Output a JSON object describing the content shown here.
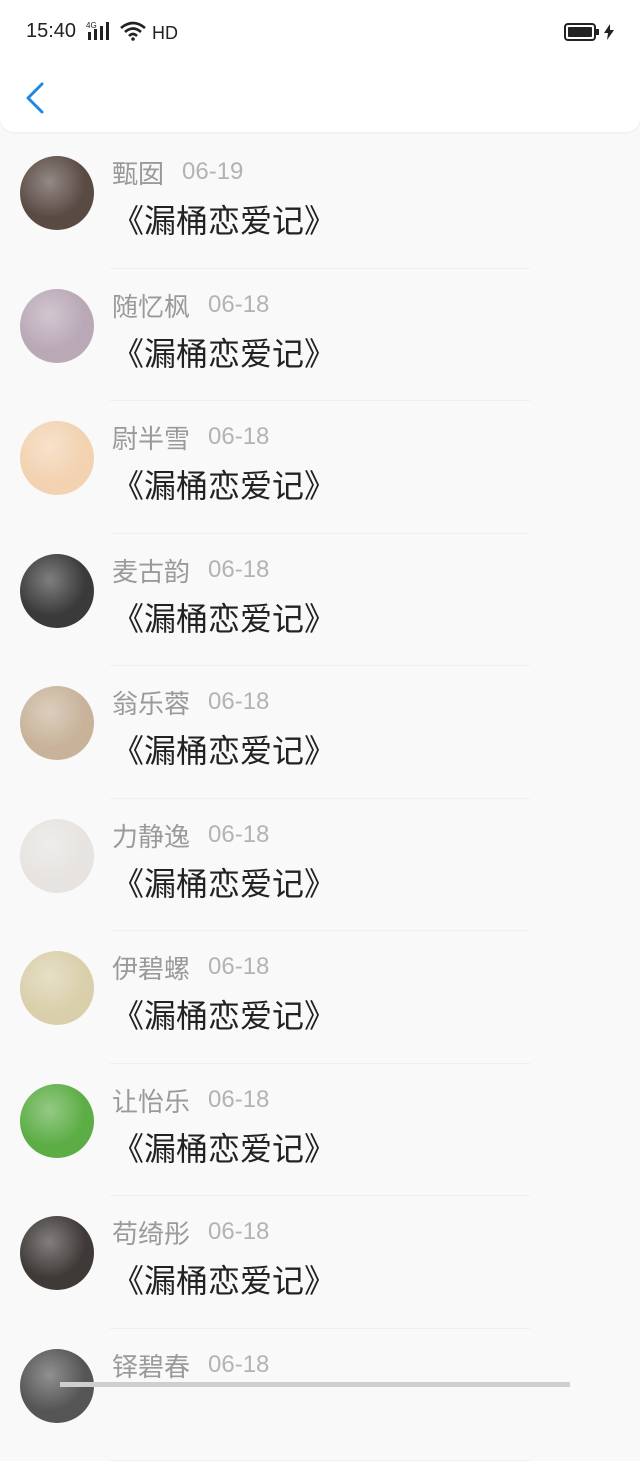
{
  "status_bar": {
    "time": "15:40",
    "network": "4G",
    "quality": "HD"
  },
  "header": {
    "back_icon": "chevron-left-icon",
    "accent_color": "#1e88e5"
  },
  "items": [
    {
      "name": "甄囡",
      "date": "06-19",
      "title": "《漏桶恋爱记》",
      "avatar_color": "#5a4a44"
    },
    {
      "name": "随忆枫",
      "date": "06-18",
      "title": "《漏桶恋爱记》",
      "avatar_color": "#b9a8b6"
    },
    {
      "name": "尉半雪",
      "date": "06-18",
      "title": "《漏桶恋爱记》",
      "avatar_color": "#f2d2b0"
    },
    {
      "name": "麦古韵",
      "date": "06-18",
      "title": "《漏桶恋爱记》",
      "avatar_color": "#3a3a3a"
    },
    {
      "name": "翁乐蓉",
      "date": "06-18",
      "title": "《漏桶恋爱记》",
      "avatar_color": "#c8b39a"
    },
    {
      "name": "力静逸",
      "date": "06-18",
      "title": "《漏桶恋爱记》",
      "avatar_color": "#e6e3e0"
    },
    {
      "name": "伊碧螺",
      "date": "06-18",
      "title": "《漏桶恋爱记》",
      "avatar_color": "#d9cfaa"
    },
    {
      "name": "让怡乐",
      "date": "06-18",
      "title": "《漏桶恋爱记》",
      "avatar_color": "#5cad45"
    },
    {
      "name": "苟绮彤",
      "date": "06-18",
      "title": "《漏桶恋爱记》",
      "avatar_color": "#3f3a38"
    },
    {
      "name": "铎碧春",
      "date": "06-18",
      "title": "",
      "avatar_color": "#555555"
    }
  ]
}
